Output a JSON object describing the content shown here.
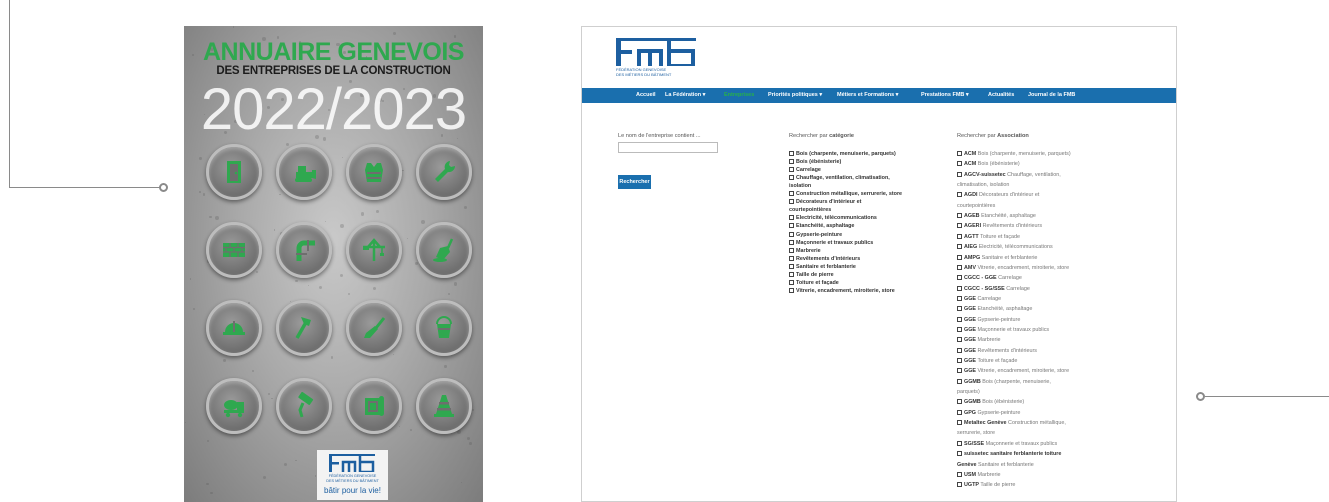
{
  "cover": {
    "title": "ANNUAIRE GENEVOIS",
    "subtitle": "DES ENTREPRISES DE LA CONSTRUCTION",
    "years": "2022/2023",
    "icons": [
      "door-icon",
      "bulldozer-icon",
      "safety-vest-icon",
      "wrench-icon",
      "bricks-icon",
      "pipe-icon",
      "crane-icon",
      "trowel-icon",
      "hard-hat-icon",
      "hammer-icon",
      "brush-icon",
      "bucket-icon",
      "cement-mixer-icon",
      "paint-roller-icon",
      "blueprint-icon",
      "traffic-cone-icon"
    ],
    "logo": {
      "sub1": "FÉDÉRATION GENEVOISE",
      "sub2": "DES MÉTIERS DU BÂTIMENT",
      "tagline": "bâtir pour la vie!"
    }
  },
  "site": {
    "logo_sub1": "FÉDÉRATION GENEVOISE",
    "logo_sub2": "DES MÉTIERS DU BÂTIMENT",
    "nav": [
      {
        "label": "Accueil",
        "active": false
      },
      {
        "label": "La Fédération ▾",
        "active": false
      },
      {
        "label": "Entreprises",
        "active": true
      },
      {
        "label": "Priorités politiques ▾",
        "active": false
      },
      {
        "label": "Métiers et Formations ▾",
        "active": false
      },
      {
        "label": "Prestations FMB ▾",
        "active": false
      },
      {
        "label": "Actualités",
        "active": false
      },
      {
        "label": "Journal de la FMB",
        "active": false
      }
    ],
    "name_label": "Le nom de l'entreprise contient ...",
    "name_value": "",
    "search_button": "Rechercher",
    "category_heading_prefix": "Rechercher par ",
    "category_heading_bold": "catégorie",
    "categories": [
      "Bois (charpente, menuiserie, parquets)",
      "Bois (ébénisterie)",
      "Carrelage",
      "Chauffage, ventilation, climatisation,",
      "isolation",
      "Construction métallique, serrurerie, store",
      "Décorateurs d'intérieur et",
      "courtepointières",
      "Electricité, télécommunications",
      "Etanchéité, asphaltage",
      "Gypserie-peinture",
      "Maçonnerie et travaux publics",
      "Marbrerie",
      "Revêtements d'intérieurs",
      "Sanitaire et ferblanterie",
      "Taille de pierre",
      "Toiture et façade",
      "Vitrerie, encadrement, miroiterie, store"
    ],
    "association_heading_prefix": "Rechercher par ",
    "association_heading_bold": "Association",
    "associations": [
      {
        "code": "ACM",
        "rest": "Bois (charpente, menuiserie, parquets)"
      },
      {
        "code": "ACM",
        "rest": "Bois (ébénisterie)"
      },
      {
        "code": "AGCV-suissetec",
        "rest": "Chauffage, ventilation,"
      },
      {
        "code": "",
        "rest": "climatisation, isolation"
      },
      {
        "code": "AGDI",
        "rest": "Décorateurs d'intérieur et"
      },
      {
        "code": "",
        "rest": "courtepointières"
      },
      {
        "code": "AGEB",
        "rest": "Etanchéité, asphaltage"
      },
      {
        "code": "AGERI",
        "rest": "Revêtements d'intérieurs"
      },
      {
        "code": "AGTT",
        "rest": "Toiture et façade"
      },
      {
        "code": "AIEG",
        "rest": "Electricité, télécommunications"
      },
      {
        "code": "AMPG",
        "rest": "Sanitaire et ferblanterie"
      },
      {
        "code": "AMV",
        "rest": "Vitrerie, encadrement, miroiterie, store"
      },
      {
        "code": "CGCC - GGE",
        "rest": "Carrelage"
      },
      {
        "code": "CGCC - SG/SSE",
        "rest": "Carrelage"
      },
      {
        "code": "GGE",
        "rest": "Carrelage"
      },
      {
        "code": "GGE",
        "rest": "Etanchéité, asphaltage"
      },
      {
        "code": "GGE",
        "rest": "Gypserie-peinture"
      },
      {
        "code": "GGE",
        "rest": "Maçonnerie et travaux publics"
      },
      {
        "code": "GGE",
        "rest": "Marbrerie"
      },
      {
        "code": "GGE",
        "rest": "Revêtements d'intérieurs"
      },
      {
        "code": "GGE",
        "rest": "Toiture et façade"
      },
      {
        "code": "GGE",
        "rest": "Vitrerie, encadrement, miroiterie, store"
      },
      {
        "code": "GGMB",
        "rest": "Bois (charpente, menuiserie,"
      },
      {
        "code": "",
        "rest": "parquets)"
      },
      {
        "code": "GGMB",
        "rest": "Bois (ébénisterie)"
      },
      {
        "code": "GPG",
        "rest": "Gypserie-peinture"
      },
      {
        "code": "Metaltec Genève",
        "rest": "Construction métallique,"
      },
      {
        "code": "",
        "rest": "serrurerie, store"
      },
      {
        "code": "SG/SSE",
        "rest": "Maçonnerie et travaux publics"
      },
      {
        "code": "suissetec sanitaire ferblanterie toiture",
        "rest": ""
      },
      {
        "code": "Genève",
        "rest": "Sanitaire et ferblanterie"
      },
      {
        "code": "USM",
        "rest": "Marbrerie"
      },
      {
        "code": "UGTP",
        "rest": "Taille de pierre"
      }
    ]
  },
  "colors": {
    "brand_blue": "#1a6fae",
    "brand_green": "#2fa84f"
  }
}
